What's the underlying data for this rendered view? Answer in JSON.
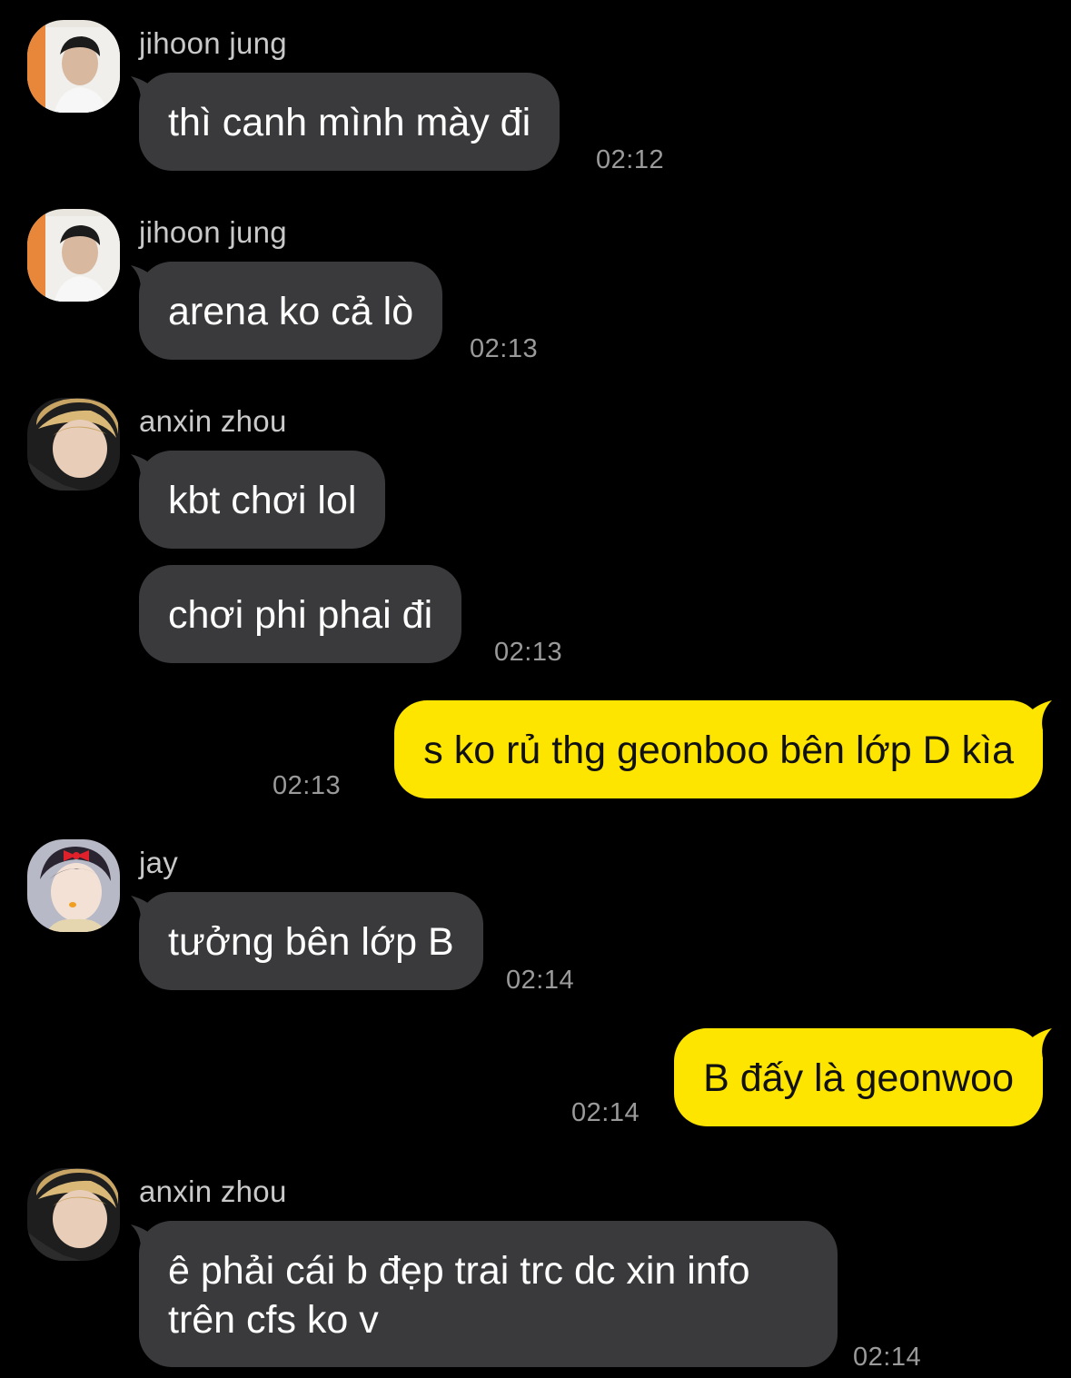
{
  "colors": {
    "background": "#000000",
    "incoming_bubble": "#3a3a3c",
    "outgoing_bubble": "#fee500",
    "sender_name": "#c9c9c9",
    "timestamp": "#9a9a9a"
  },
  "messages": [
    {
      "sender": "jihoon jung",
      "avatar": "jihoon-avatar",
      "texts": [
        "thì canh mình mày đi"
      ],
      "time": "02:12"
    },
    {
      "sender": "jihoon jung",
      "avatar": "jihoon-avatar",
      "texts": [
        "arena ko cả lò"
      ],
      "time": "02:13"
    },
    {
      "sender": "anxin zhou",
      "avatar": "anxin-avatar",
      "texts": [
        "kbt chơi lol",
        "chơi phi phai đi"
      ],
      "time": "02:13"
    },
    {
      "sender": "me",
      "texts": [
        "s ko rủ thg geonboo bên lớp D kìa"
      ],
      "time": "02:13"
    },
    {
      "sender": "jay",
      "avatar": "jay-avatar",
      "texts": [
        "tưởng bên lớp B"
      ],
      "time": "02:14"
    },
    {
      "sender": "me",
      "texts": [
        "B đấy là geonwoo"
      ],
      "time": "02:14"
    },
    {
      "sender": "anxin zhou",
      "avatar": "anxin-avatar",
      "texts": [
        "ê phải cái b đẹp trai trc dc xin info",
        "trên cfs ko v"
      ],
      "time": "02:14"
    }
  ]
}
